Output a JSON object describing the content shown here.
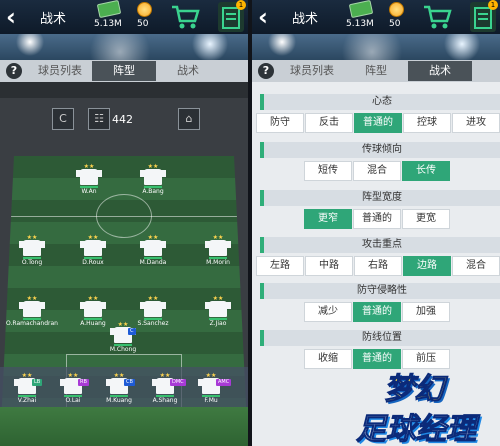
{
  "header": {
    "title": "战术",
    "money": "5.13M",
    "coins": "50",
    "notification_count": "1",
    "icons": [
      "back-icon",
      "money-icon",
      "coin-icon",
      "shop-cart-icon",
      "clipboard-icon"
    ]
  },
  "tabs": [
    {
      "label": "球员列表"
    },
    {
      "label": "阵型"
    },
    {
      "label": "战术"
    }
  ],
  "left": {
    "active_tab": "阵型",
    "formation_value": "442",
    "left_button_label": "C",
    "players": [
      {
        "name": "W.An",
        "tag": ""
      },
      {
        "name": "A.Bang",
        "tag": ""
      },
      {
        "name": "O.Tong",
        "tag": ""
      },
      {
        "name": "D.Roux",
        "tag": ""
      },
      {
        "name": "M.Danda",
        "tag": ""
      },
      {
        "name": "M.Morin",
        "tag": ""
      },
      {
        "name": "O.Ramachandran",
        "tag": ""
      },
      {
        "name": "A.Huang",
        "tag": ""
      },
      {
        "name": "S.Sanchez",
        "tag": ""
      },
      {
        "name": "Z.Jiao",
        "tag": ""
      },
      {
        "name": "M.Chong",
        "tag": "C"
      },
      {
        "name": "V.Zhai",
        "tag": "LB"
      },
      {
        "name": "O.Lai",
        "tag": "RB"
      },
      {
        "name": "M.Kuang",
        "tag": "CB"
      },
      {
        "name": "A.Shang",
        "tag": "DMC"
      },
      {
        "name": "F.Mu",
        "tag": "AMC"
      }
    ]
  },
  "right": {
    "active_tab": "战术",
    "sections": [
      {
        "title": "心态",
        "options": [
          "防守",
          "反击",
          "普通的",
          "控球",
          "进攻"
        ],
        "selected": 2
      },
      {
        "title": "传球倾向",
        "options": [
          "短传",
          "混合",
          "长传"
        ],
        "selected": 2
      },
      {
        "title": "阵型宽度",
        "options": [
          "更窄",
          "普通的",
          "更宽"
        ],
        "selected": 0
      },
      {
        "title": "攻击重点",
        "options": [
          "左路",
          "中路",
          "右路",
          "边路",
          "混合"
        ],
        "selected": 3
      },
      {
        "title": "防守侵略性",
        "options": [
          "减少",
          "普通的",
          "加强"
        ],
        "selected": 1
      },
      {
        "title": "防线位置",
        "options": [
          "收缩",
          "普通的",
          "前压"
        ],
        "selected": 1
      }
    ],
    "logo_line1": "梦幻",
    "logo_line2": "足球经理"
  },
  "colors": {
    "accent": "#2fa678",
    "header_bg": "#0e1a29",
    "coin": "#f9a825",
    "money": "#4caf50"
  }
}
